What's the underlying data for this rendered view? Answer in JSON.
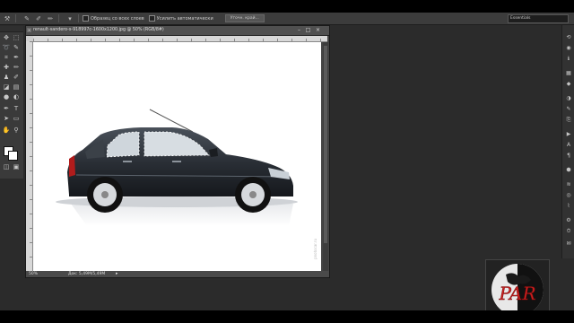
{
  "options_bar": {
    "auto_select_label": "Образец со всех слоев",
    "auto_enhance_label": "Усилить автоматически",
    "refine_edge_button": "Уточн. край..."
  },
  "workspace": {
    "selected": "Essentials"
  },
  "document": {
    "title": "renault-sandero-s-918997c-1600x1200.jpg @ 50% (RGB/8#)",
    "close_glyph": "×",
    "canvas_side_text": "pnotocar.ru"
  },
  "status_bar": {
    "zoom": "50%",
    "doc_size": "Док: 5,49М/5,49М",
    "arrow": "▸"
  },
  "colors": {
    "app_background": "#2b2b2b",
    "panel": "#3c3c3c",
    "car_body": "#2a2f36",
    "foreground_swatch": "#ffffff",
    "background_swatch": "#ffffff",
    "logo_red": "#cc1f1f"
  },
  "logo": {
    "text": "PAR"
  },
  "toolbox_icons": [
    "move-icon",
    "marquee-icon",
    "lasso-icon",
    "quick-select-icon",
    "crop-icon",
    "eyedropper-icon",
    "healing-icon",
    "brush-icon",
    "stamp-icon",
    "history-brush-icon",
    "eraser-icon",
    "gradient-icon",
    "blur-icon",
    "dodge-icon",
    "pen-icon",
    "type-icon",
    "path-select-icon",
    "shape-icon",
    "hand-icon",
    "zoom-icon"
  ],
  "right_panel_icons": [
    "history-icon",
    "adjust-icon",
    "info-icon",
    "swatches-icon",
    "styles-icon",
    "color-icon",
    "brush-panel-icon",
    "clone-source-icon",
    "actions-icon",
    "character-icon",
    "paragraph-icon",
    "3d-icon",
    "layers-icon",
    "channels-icon",
    "paths-icon",
    "properties-icon"
  ]
}
